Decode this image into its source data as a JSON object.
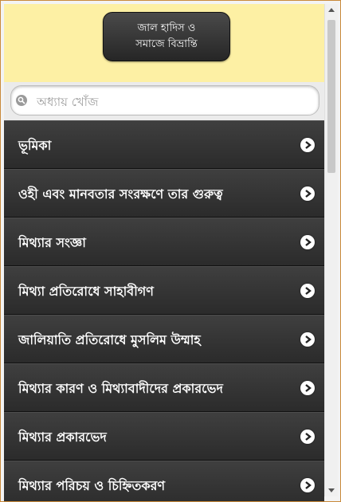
{
  "header": {
    "title": "জাল হাদিস ও সমাজে বিভ্রান্তি"
  },
  "search": {
    "placeholder": "অধ্যায় খোঁজ"
  },
  "chapters": [
    {
      "label": "ভূমিকা"
    },
    {
      "label": "ওহী এবং মানবতার সংরক্ষণে তার গুরুত্ব"
    },
    {
      "label": "মিথ্যার সংজ্ঞা"
    },
    {
      "label": "মিথ্যা প্রতিরোধে সাহাবীগণ"
    },
    {
      "label": "জালিয়াতি প্রতিরোধে মুসলিম উম্মাহ"
    },
    {
      "label": "মিথ্যার কারণ ও মিথ্যাবাদীদের প্রকারভেদ"
    },
    {
      "label": "মিথ্যার প্রকারভেদ"
    },
    {
      "label": "মিথ্যার পরিচয় ও চিহ্নিতকরণ"
    }
  ],
  "colors": {
    "header_bg": "#fdf0a4",
    "list_bg": "#333333",
    "frame_border": "#c98a3a"
  },
  "icons": {
    "search": "search-icon",
    "row_arrow": "arrow-right-icon"
  }
}
